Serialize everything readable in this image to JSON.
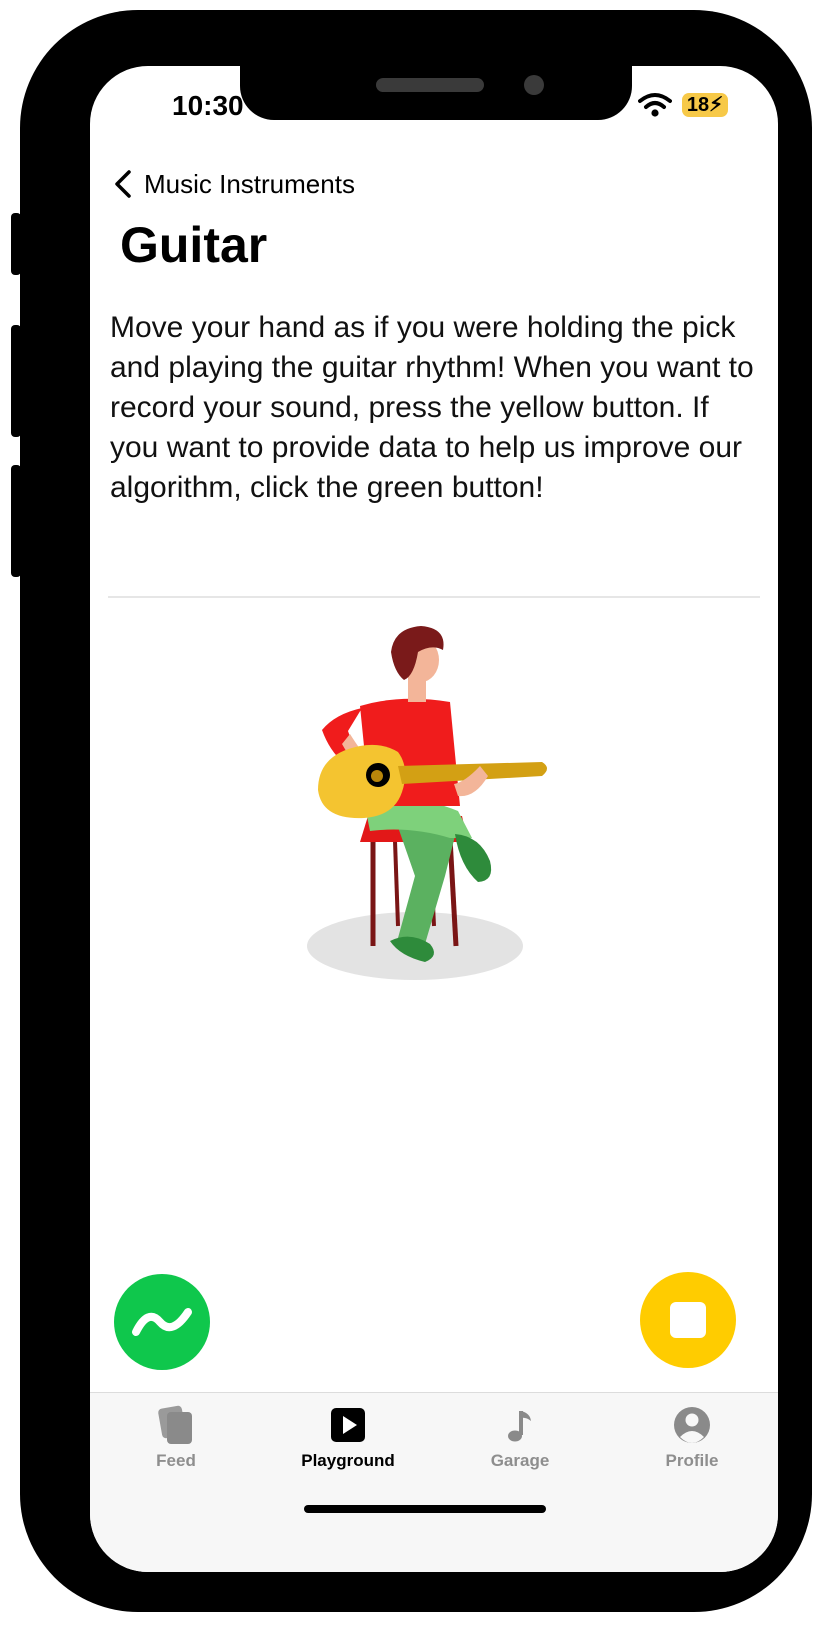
{
  "status_bar": {
    "time": "10:30",
    "battery": "18"
  },
  "nav": {
    "back_label": "Music Instruments"
  },
  "page": {
    "title": "Guitar",
    "description": "Move your hand as if you were holding the pick and playing the guitar rhythm! When you want to record your sound, press the yellow button. If you want to provide data to help us improve our algorithm, click the green button!"
  },
  "actions": {
    "data_button_color": "#0fc74c",
    "record_button_color": "#ffcc00",
    "data_icon": "squiggle-icon",
    "record_icon": "stop-icon"
  },
  "tabs": [
    {
      "label": "Feed",
      "icon": "cards-icon",
      "active": false
    },
    {
      "label": "Playground",
      "icon": "play-icon",
      "active": true
    },
    {
      "label": "Garage",
      "icon": "music-note-icon",
      "active": false
    },
    {
      "label": "Profile",
      "icon": "person-circle-icon",
      "active": false
    }
  ]
}
